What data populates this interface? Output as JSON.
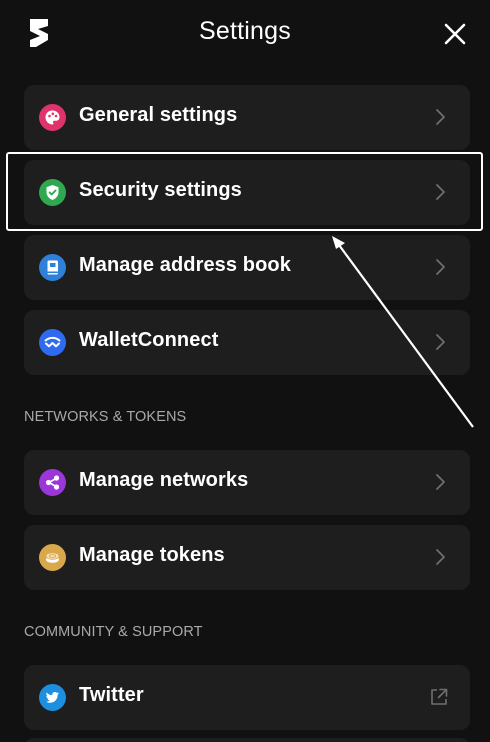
{
  "header": {
    "title": "Settings",
    "logo_icon": "brand-s-logo-icon",
    "close_icon": "close-icon"
  },
  "items": [
    {
      "label": "General settings",
      "icon": "paint-palette-icon",
      "icon_color": "#e0336b",
      "trailing": "chevron-right-icon"
    },
    {
      "label": "Security settings",
      "icon": "shield-check-icon",
      "icon_color": "#2fa84f",
      "trailing": "chevron-right-icon"
    },
    {
      "label": "Manage address book",
      "icon": "address-book-icon",
      "icon_color": "#2f80d8",
      "trailing": "chevron-right-icon"
    },
    {
      "label": "WalletConnect",
      "icon": "walletconnect-icon",
      "icon_color": "#2e6bf0",
      "trailing": "chevron-right-icon"
    }
  ],
  "sections": {
    "networks": {
      "title": "NETWORKS & TOKENS",
      "items": [
        {
          "label": "Manage networks",
          "icon": "share-nodes-icon",
          "icon_color": "#9b36d8",
          "trailing": "chevron-right-icon"
        },
        {
          "label": "Manage tokens",
          "icon": "coins-icon",
          "icon_color": "#d9a84a",
          "trailing": "chevron-right-icon"
        }
      ]
    },
    "community": {
      "title": "COMMUNITY & SUPPORT",
      "items": [
        {
          "label": "Twitter",
          "icon": "twitter-bird-icon",
          "icon_color": "#1d8fe0",
          "trailing": "external-link-icon"
        }
      ]
    }
  },
  "colors": {
    "background": "#111111",
    "card": "#1e1e1e",
    "text": "#ffffff",
    "muted": "#a9a9a9",
    "chevron": "#6f6f6f"
  }
}
